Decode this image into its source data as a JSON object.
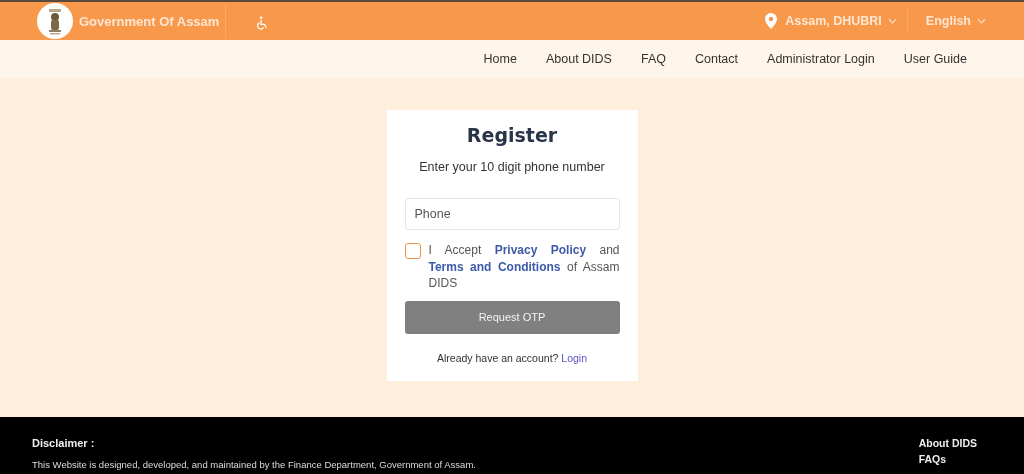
{
  "header": {
    "title": "Government Of Assam",
    "location": "Assam, DHUBRI",
    "language": "English"
  },
  "nav": [
    {
      "label": "Home"
    },
    {
      "label": "About DIDS"
    },
    {
      "label": "FAQ"
    },
    {
      "label": "Contact"
    },
    {
      "label": "Administrator Login"
    },
    {
      "label": "User Guide"
    }
  ],
  "register": {
    "title": "Register",
    "subtitle": "Enter your 10 digit phone number",
    "phone": {
      "placeholder": "Phone"
    },
    "accept": {
      "checked": false,
      "parts": [
        {
          "kind": "text",
          "text": "I Accept"
        },
        {
          "kind": "link",
          "text": "Privacy Policy"
        },
        {
          "kind": "text",
          "text": "and"
        },
        {
          "kind": "link",
          "text": "Terms and Conditions"
        },
        {
          "kind": "text",
          "text": "of Assam DIDS"
        }
      ]
    },
    "button": "Request OTP",
    "login_prompt": "Already have an account?",
    "login_link": "Login"
  },
  "footer": {
    "heading": "Disclaimer :",
    "text": "This Website is designed, developed, and maintained by the Finance Department, Government of Assam.",
    "links": [
      "About DIDS",
      "FAQs"
    ]
  }
}
